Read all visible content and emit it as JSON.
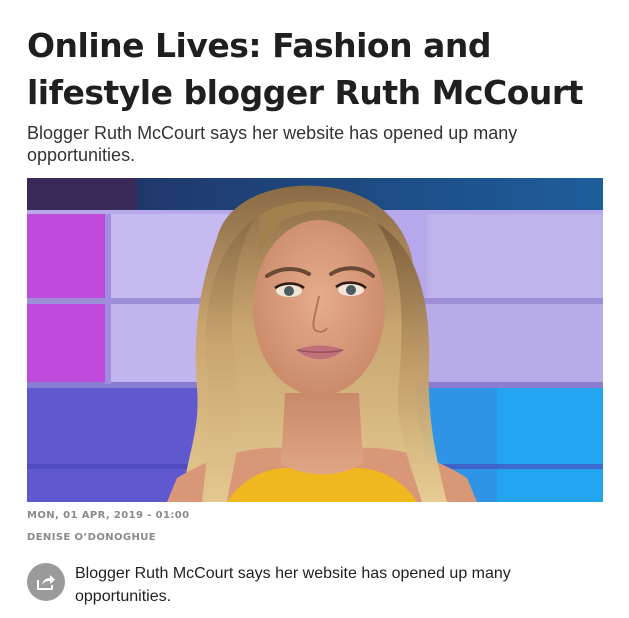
{
  "article": {
    "title": "Online Lives: Fashion and lifestyle blogger Ruth McCourt",
    "standfirst": "Blogger Ruth McCourt says her website has opened up many opportunities.",
    "date": "MON, 01 APR, 2019 - 01:00",
    "author": "DENISE O’DONOGHUE",
    "caption": "Blogger Ruth McCourt says her website has opened up many opportunities."
  },
  "icons": {
    "share": "share-icon"
  },
  "colors": {
    "meta_text": "#8a8a8a",
    "share_button": "#9a9a9a"
  }
}
